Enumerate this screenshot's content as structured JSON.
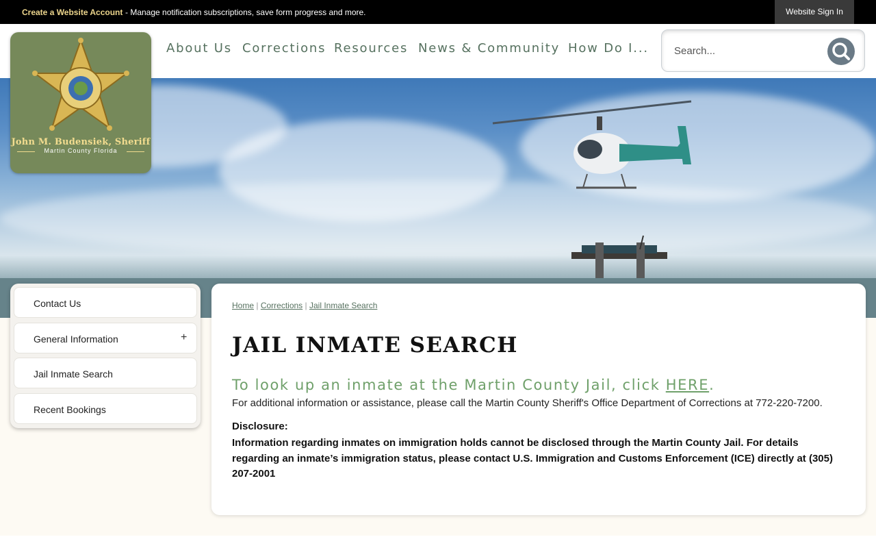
{
  "topbar": {
    "create_account": "Create a Website Account",
    "manage_text": "- Manage notification subscriptions, save form progress and more.",
    "sign_in": "Website Sign In"
  },
  "logo": {
    "name": "John M. Budensiek, Sheriff",
    "county": "Martin County Florida"
  },
  "nav": {
    "items": [
      "About Us",
      "Corrections",
      "Resources",
      "News & Community",
      "How Do I..."
    ]
  },
  "search": {
    "placeholder": "Search..."
  },
  "sidebar": {
    "items": [
      {
        "label": "Contact Us"
      },
      {
        "label": "General Information",
        "toggle": "+"
      },
      {
        "label": "Jail Inmate Search"
      },
      {
        "label": "Recent Bookings"
      }
    ]
  },
  "breadcrumb": {
    "home": "Home",
    "sep": "|",
    "corrections": "Corrections",
    "current": "Jail Inmate Search"
  },
  "content": {
    "title": "JAIL INMATE SEARCH",
    "lookup_prefix": "To look up an inmate at the Martin County Jail, click ",
    "lookup_link": "HERE",
    "lookup_suffix": ".",
    "info": "For additional information or assistance, please call the Martin County Sheriff's Office Department of Corrections at 772-220-7200.",
    "disclosure_heading": "Disclosure:",
    "disclosure_text": "Information regarding inmates on immigration holds cannot be disclosed through the Martin County Jail. For details regarding an inmate’s immigration status, please contact U.S. Immigration and Customs Enforcement (ICE) directly at (305) 207-2001"
  },
  "colors": {
    "nav": "#56715f",
    "accent_green": "#6fa06a",
    "logo_bg": "#76895a",
    "gold": "#f2dc8f"
  }
}
